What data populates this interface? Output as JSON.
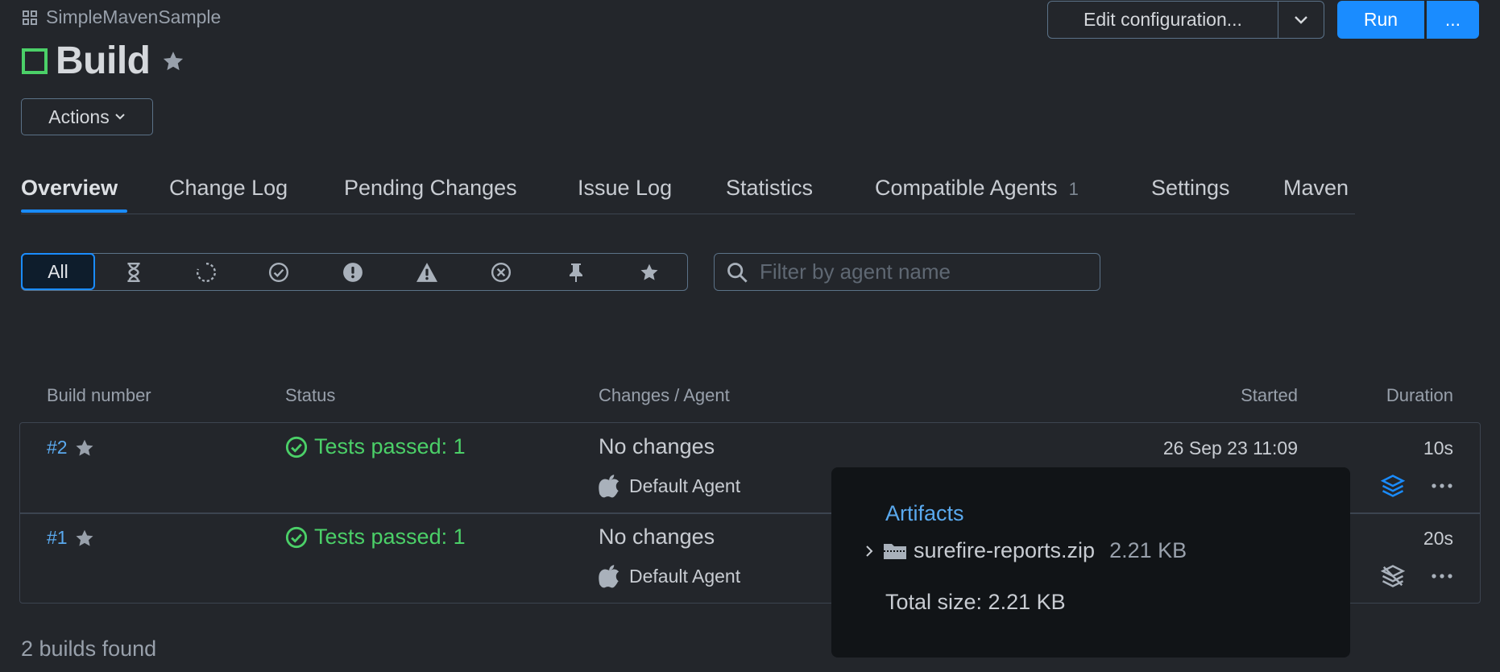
{
  "header": {
    "project": "SimpleMavenSample",
    "title": "Build",
    "actions_label": "Actions",
    "edit_config_label": "Edit configuration...",
    "run_label": "Run",
    "more_label": "..."
  },
  "tabs": [
    {
      "label": "Overview",
      "active": true
    },
    {
      "label": "Change Log"
    },
    {
      "label": "Pending Changes"
    },
    {
      "label": "Issue Log"
    },
    {
      "label": "Statistics"
    },
    {
      "label": "Compatible Agents",
      "count": "1"
    },
    {
      "label": "Settings"
    },
    {
      "label": "Maven"
    }
  ],
  "filters": {
    "all_label": "All",
    "icons": [
      "hourglass-icon",
      "running-icon",
      "success-icon",
      "error-icon",
      "warning-icon",
      "failed-icon",
      "pin-icon",
      "star-icon"
    ],
    "search_placeholder": "Filter by agent name"
  },
  "table": {
    "columns": [
      "Build number",
      "Status",
      "Changes / Agent",
      "Started",
      "Duration"
    ],
    "rows": [
      {
        "number": "#2",
        "status": "Tests passed: 1",
        "changes": "No changes",
        "agent": "Default Agent",
        "started": "26 Sep 23 11:09",
        "duration": "10s"
      },
      {
        "number": "#1",
        "status": "Tests passed: 1",
        "changes": "No changes",
        "agent": "Default Agent",
        "started": "",
        "duration": "20s"
      }
    ],
    "footer": "2 builds found"
  },
  "artifacts_popup": {
    "title": "Artifacts",
    "file": "surefire-reports.zip",
    "file_size": "2.21 KB",
    "total": "Total size: 2.21 KB"
  },
  "colors": {
    "accent": "#1a8cff",
    "success": "#4bd068",
    "link": "#5aa9ee",
    "build_status_square": "#4bd068"
  }
}
